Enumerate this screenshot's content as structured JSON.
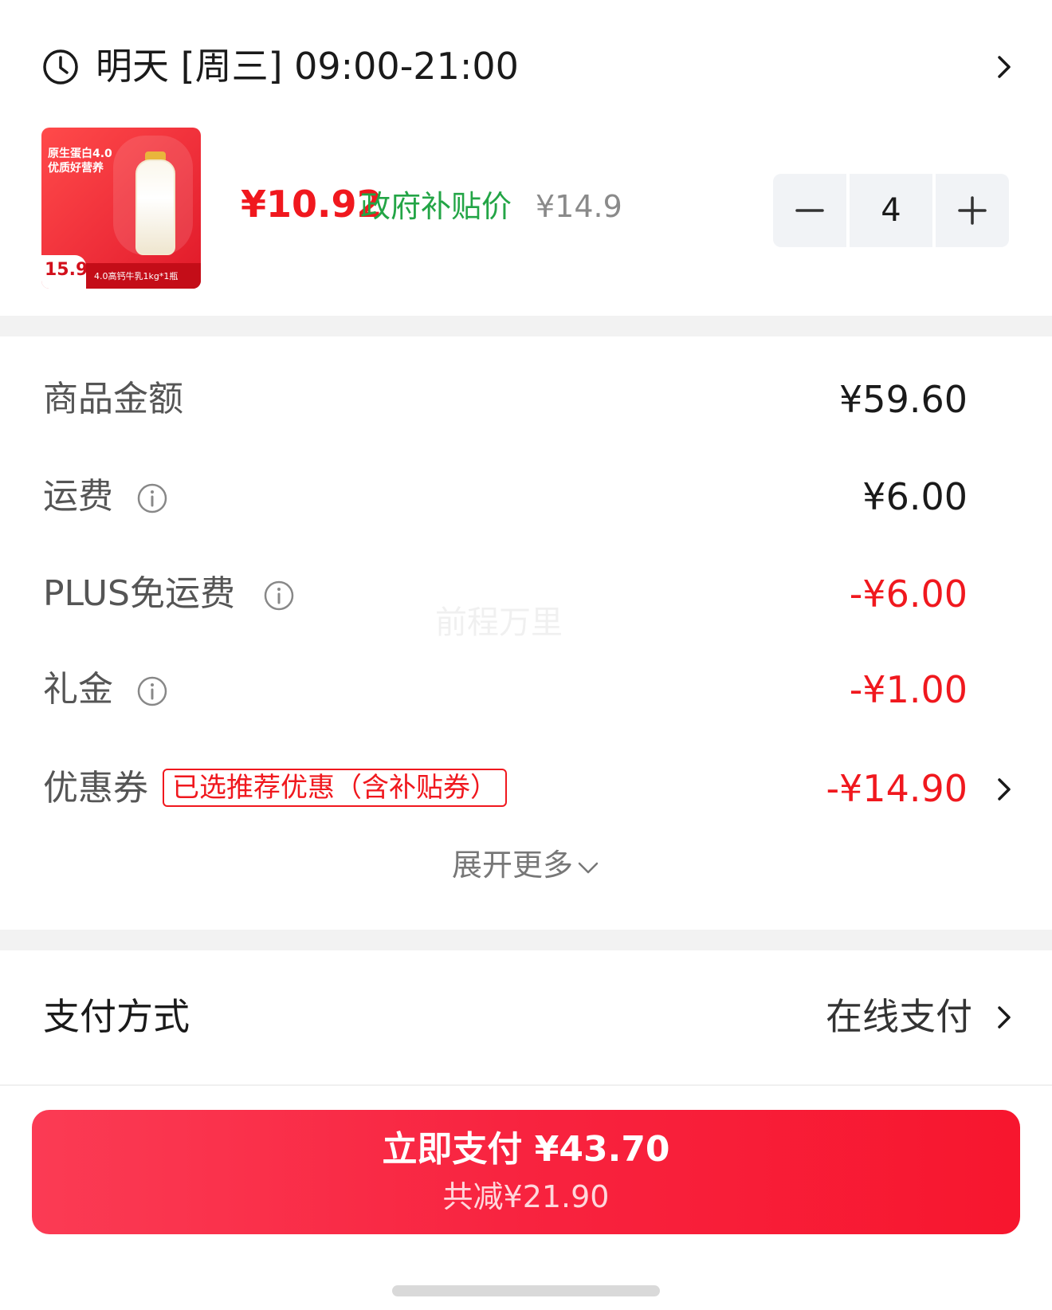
{
  "delivery": {
    "time_text": "明天 [周三] 09:00-21:00",
    "icon": "clock-icon"
  },
  "product": {
    "thumb_headline": "原生蛋白4.0\n优质好营养",
    "thumb_price": "15.9",
    "thumb_caption": "4.0高钙牛乳1kg*1瓶",
    "subsidy_price": "¥10.92",
    "subsidy_label": "政府补贴价",
    "original_price": "¥14.9",
    "quantity": "4"
  },
  "summary": {
    "rows": [
      {
        "label": "商品金额",
        "value": "¥59.60",
        "info": false
      },
      {
        "label": "运费",
        "value": "¥6.00",
        "info": true
      },
      {
        "label": "PLUS免运费",
        "value": "-¥6.00",
        "info": true
      },
      {
        "label": "礼金",
        "value": "-¥1.00",
        "info": true
      },
      {
        "label": "优惠券",
        "value": "-¥14.90",
        "tag": "已选推荐优惠（含补贴券）"
      }
    ],
    "expand_label": "展开更多"
  },
  "watermark": "前程万里",
  "payment": {
    "label": "支付方式",
    "value": "在线支付"
  },
  "pay_button": {
    "main": "立即支付 ¥43.70",
    "sub": "共减¥21.90"
  },
  "colors": {
    "accent_red": "#f0181e",
    "subsidy_green": "#23a546",
    "button_red": "#f8233f"
  }
}
